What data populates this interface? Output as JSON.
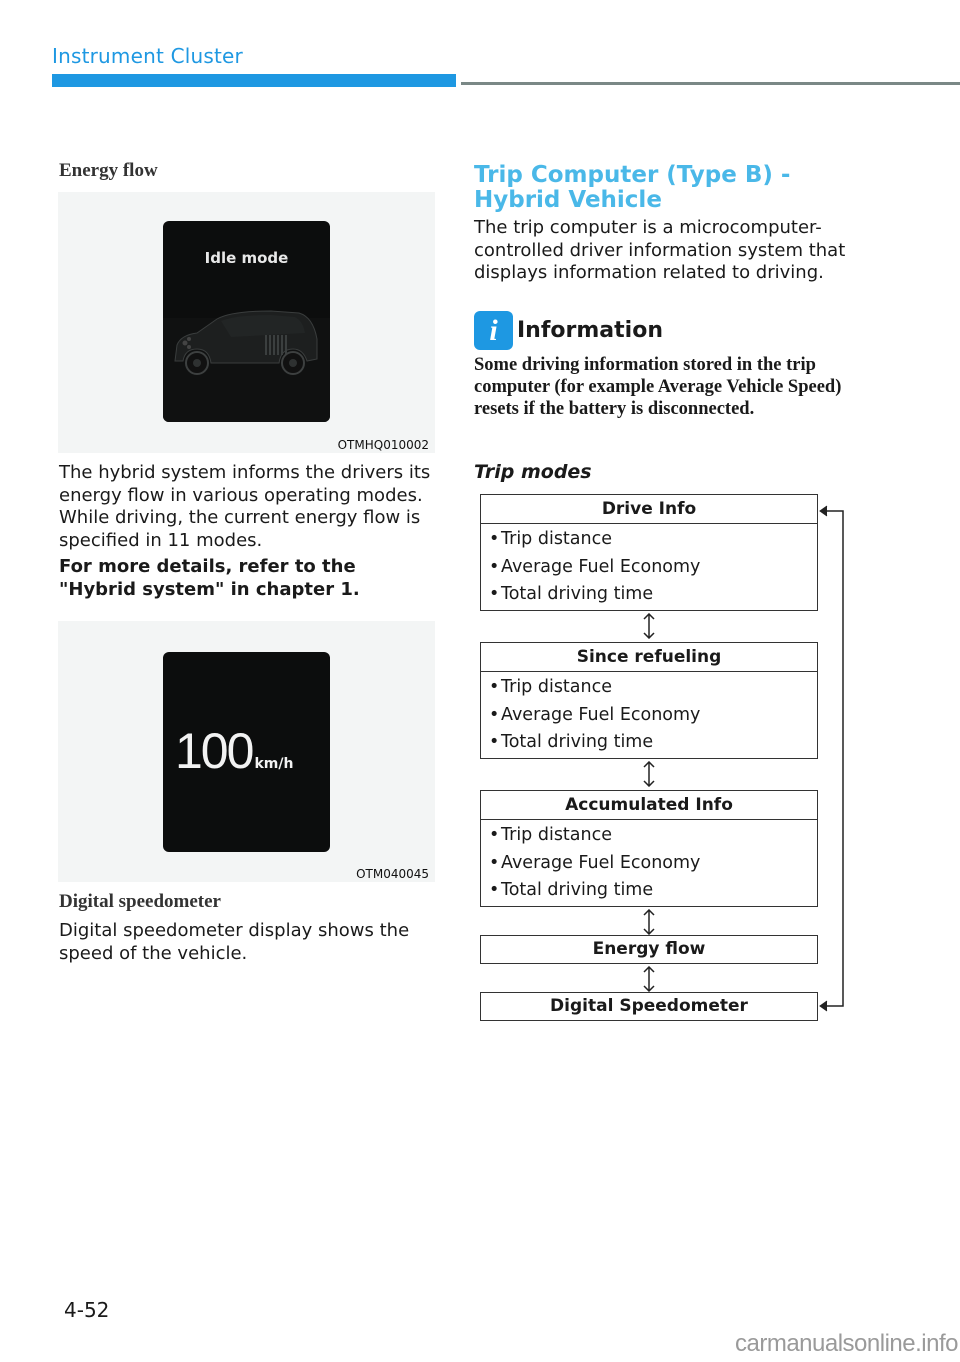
{
  "header": {
    "section_title": "Instrument Cluster",
    "accent_color": "#1e98e2"
  },
  "left": {
    "energy_flow": {
      "heading": "Energy flow",
      "figure": {
        "screen_label": "Idle mode",
        "code": "OTMHQ010002"
      },
      "paragraph": "The hybrid system informs the drivers its energy flow in various operating modes. While driving, the current energy flow is specified in 11 modes.",
      "note": "For more details, refer to the \"Hybrid system\" in chapter 1."
    },
    "digital_speedometer": {
      "figure": {
        "speed_value": "100",
        "speed_unit": "km/h",
        "code": "OTM040045"
      },
      "heading": "Digital speedometer",
      "paragraph": "Digital speedometer display shows the speed of the vehicle."
    }
  },
  "right": {
    "heading": "Trip Computer (Type B) - Hybrid Vehicle",
    "intro": "The trip computer is a microcomputer-controlled driver information system that displays information related to driving.",
    "information": {
      "icon": "info-icon",
      "title": "Information",
      "text": "Some driving information stored in the trip computer (for example Average Vehicle Speed) resets if the battery is disconnected."
    },
    "trip_modes": {
      "title": "Trip modes",
      "modes": [
        {
          "name": "Drive Info",
          "items": [
            "Trip distance",
            "Average Fuel Economy",
            "Total driving time"
          ]
        },
        {
          "name": "Since refueling",
          "items": [
            "Trip distance",
            "Average Fuel Economy",
            "Total driving time"
          ]
        },
        {
          "name": "Accumulated Info",
          "items": [
            "Trip distance",
            "Average Fuel Economy",
            "Total driving time"
          ]
        },
        {
          "name": "Energy flow",
          "items": []
        },
        {
          "name": "Digital Speedometer",
          "items": []
        }
      ],
      "bullet": "•"
    }
  },
  "footer": {
    "page_number": "4-52",
    "watermark": "carmanualsonline.info"
  }
}
